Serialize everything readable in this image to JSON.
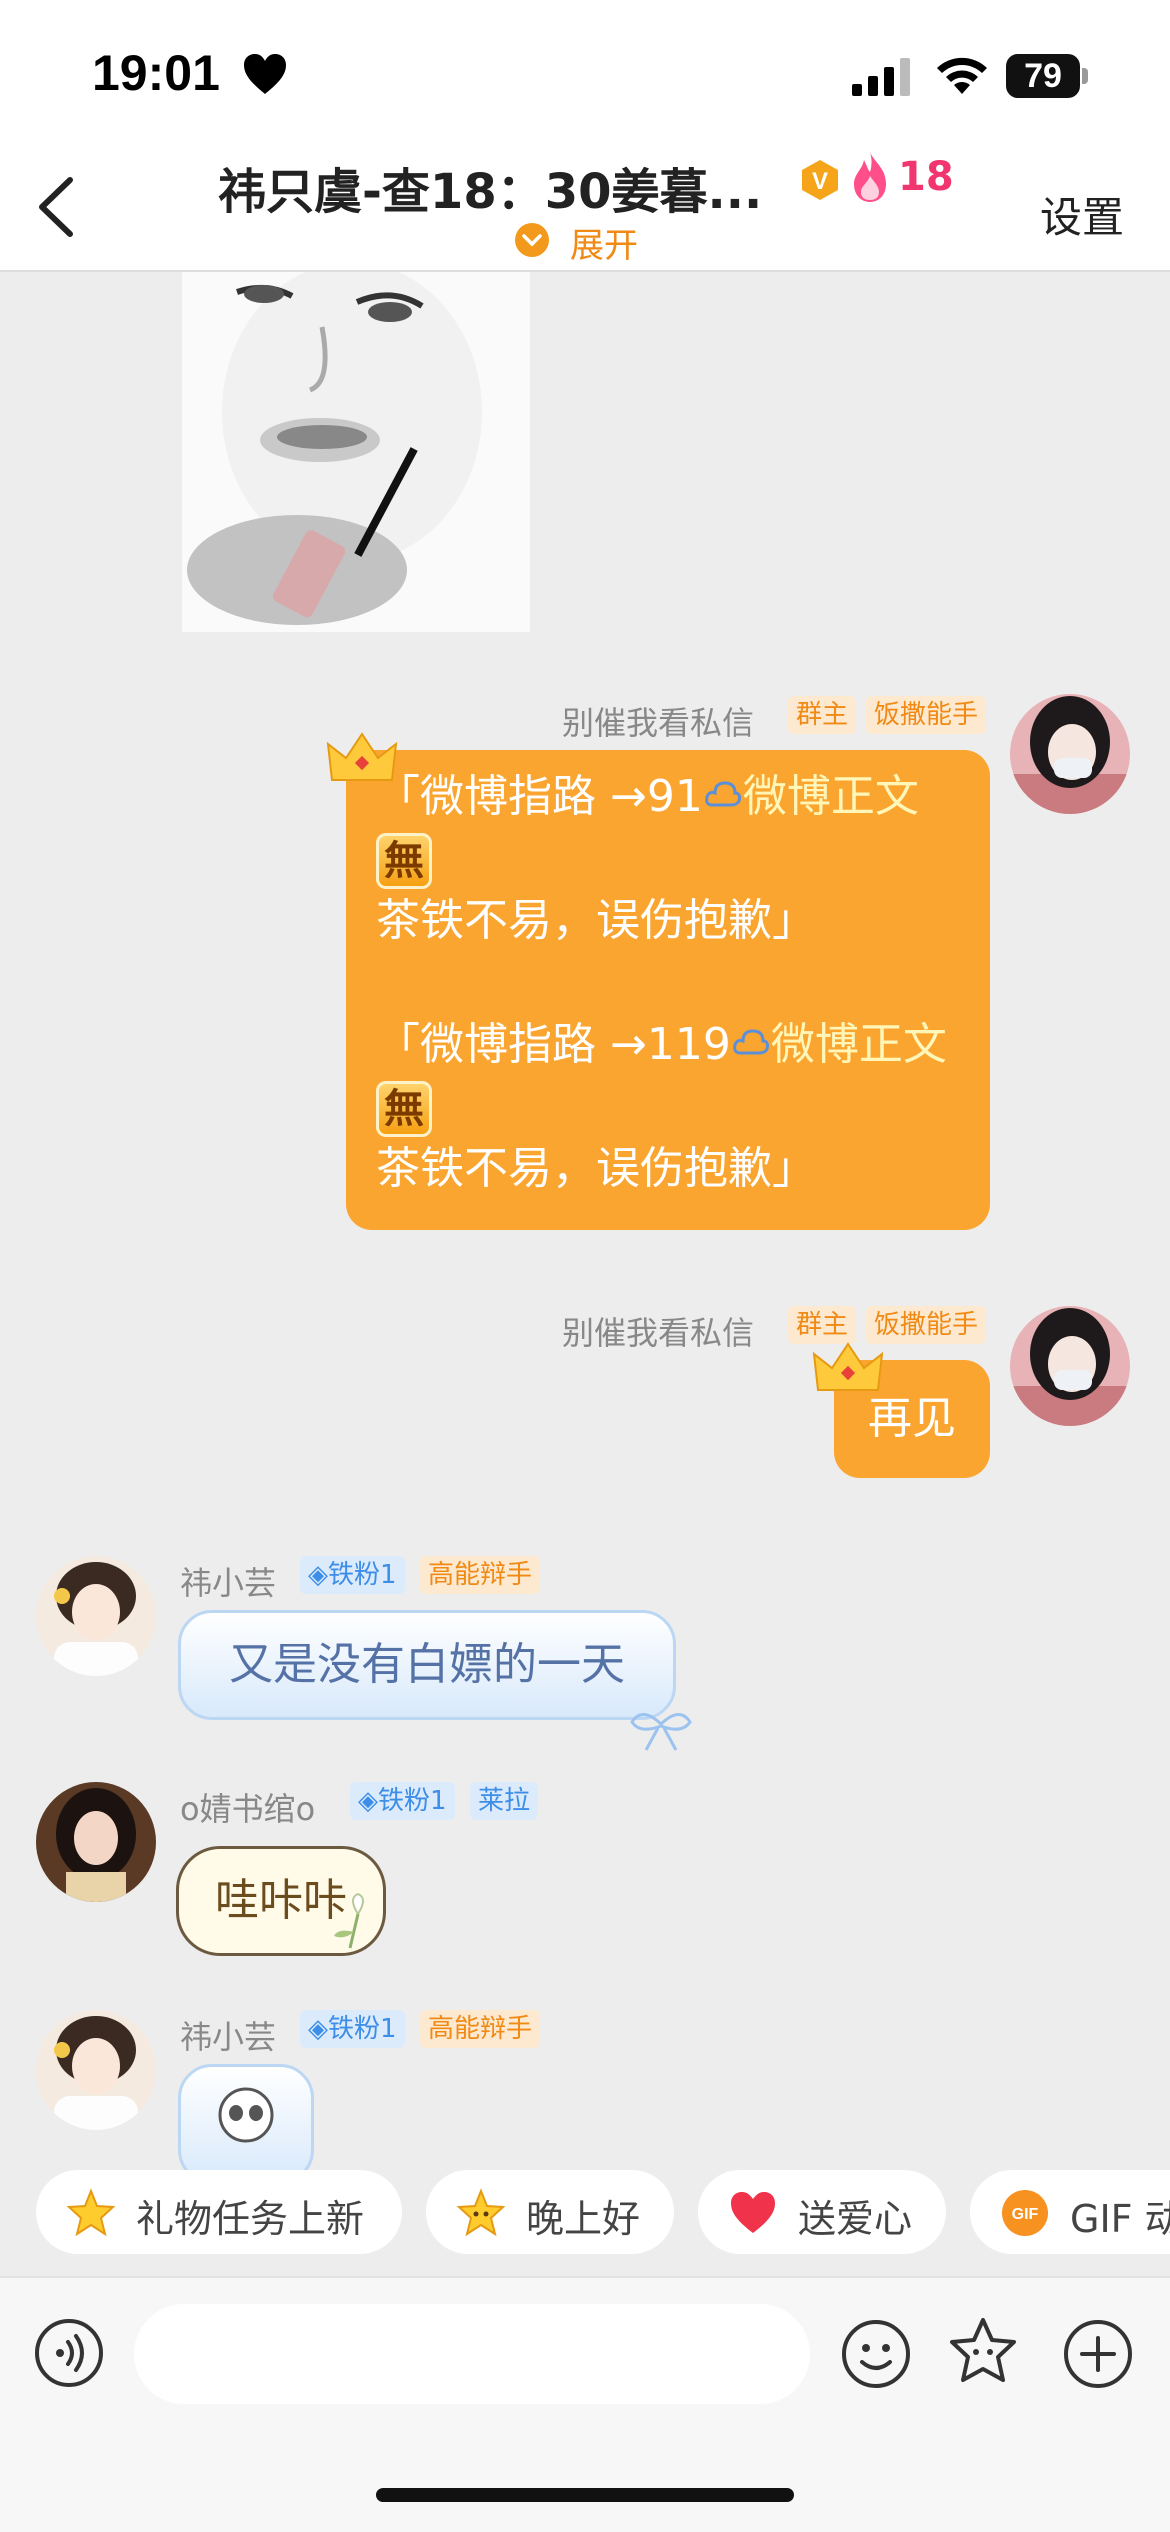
{
  "status_bar": {
    "time": "19:01",
    "battery": "79"
  },
  "nav": {
    "title": "祎只虞-查18：30姜暮...",
    "fire_count": "18",
    "expand": "展开",
    "settings": "设置"
  },
  "messages": {
    "m1": {
      "sender": "别催我看私信",
      "tags": [
        "群主",
        "饭撒能手"
      ],
      "lines": [
        {
          "prefix": "「微博指路 →91",
          "link": "微博正文"
        },
        {
          "badge": "無"
        },
        {
          "text": "茶铁不易，误伤抱歉」"
        },
        {
          "text": ""
        },
        {
          "prefix": "「微博指路 →119",
          "link": "微博正文"
        },
        {
          "badge": "無"
        },
        {
          "text": "茶铁不易，误伤抱歉」"
        }
      ]
    },
    "m2": {
      "sender": "别催我看私信",
      "tags": [
        "群主",
        "饭撒能手"
      ],
      "text": "再见"
    },
    "m3": {
      "sender": "祎小芸",
      "fan_level": "铁粉1",
      "tag": "高能辩手",
      "text": "又是没有白嫖的一天"
    },
    "m4": {
      "sender": "o婧书绾o",
      "fan_level": "铁粉1",
      "tag": "莱拉",
      "text": "哇咔咔"
    },
    "m5": {
      "sender": "祎小芸",
      "fan_level": "铁粉1",
      "tag": "高能辩手"
    }
  },
  "quick_replies": [
    "礼物任务上新",
    "晚上好",
    "送爱心",
    "GIF 动"
  ],
  "input": {
    "placeholder": ""
  },
  "colors": {
    "accent": "#fba531",
    "fire": "#f0356f",
    "tag_orange": "#f08a14",
    "tag_blue": "#3c8ee8"
  }
}
